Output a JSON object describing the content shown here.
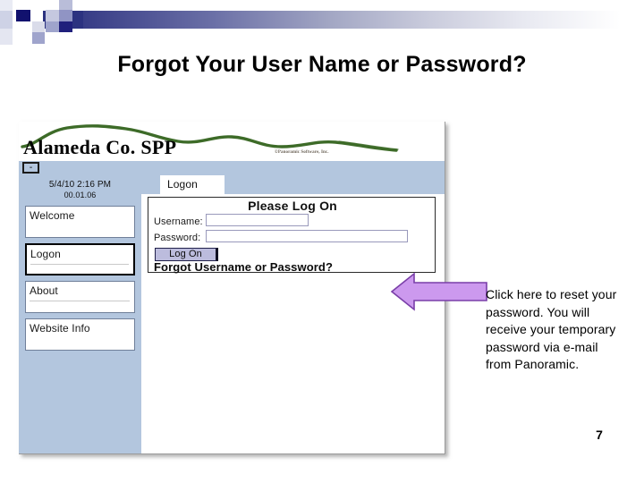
{
  "slide": {
    "title": "Forgot Your User Name or Password?",
    "page_number": "7"
  },
  "theme": {
    "banner_gradient_start": "#2c3280",
    "banner_gradient_end": "#ffffff",
    "sidebar_blue": "#b3c6de",
    "arrow_fill": "#cc99ee",
    "arrow_stroke": "#7a3fa8",
    "logo_green": "#3d6b28",
    "button_fill": "#bcbcdd"
  },
  "app": {
    "brand": "Alameda Co. SPP",
    "copyright": "©Panoramic Software, Inc.",
    "minimize_label": "-",
    "datetime": "5/4/10 2:16 PM",
    "version": "00.01.06",
    "sidebar_items": [
      {
        "label": "Welcome",
        "active": false
      },
      {
        "label": "Logon",
        "active": true
      },
      {
        "label": "About",
        "active": false
      },
      {
        "label": "Website Info",
        "active": false
      }
    ],
    "tab": {
      "label": "Logon"
    },
    "logon_panel": {
      "title": "Please Log On",
      "username_label": "Username:",
      "username_value": "",
      "username_placeholder": "",
      "password_label": "Password:",
      "password_value": "",
      "password_placeholder": "",
      "logon_button": "Log On",
      "forgot_link": "Forgot Username or Password?"
    }
  },
  "callout": {
    "text": "Click here to reset your password. You will receive your temporary password via e-mail from Panoramic."
  }
}
